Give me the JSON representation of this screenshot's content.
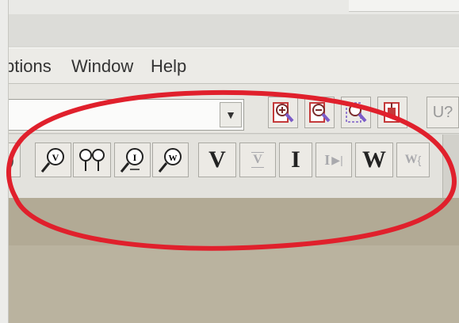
{
  "menu": {
    "options": "ptions",
    "window": "Window",
    "help": "Help"
  },
  "toolbar1": {
    "combo_value": "",
    "cut_text": "U?",
    "buttons": [
      "zoom-in-icon",
      "zoom-out-icon",
      "zoom-area-icon",
      "zoom-fit-icon"
    ]
  },
  "toolbar2": {
    "probe_buttons": [
      "voltage-probe-icon",
      "voltage-differential-probe-icon",
      "current-probe-icon",
      "power-probe-icon"
    ],
    "marker_labels": {
      "v": "V",
      "v_diff": "V",
      "i": "I",
      "i_diff": "I",
      "w": "W",
      "w_diff": "W"
    }
  },
  "colors": {
    "highlight_oval": "#e0202c",
    "magnifier_red": "#c43a3a",
    "magnifier_purple": "#7b5cc9"
  }
}
